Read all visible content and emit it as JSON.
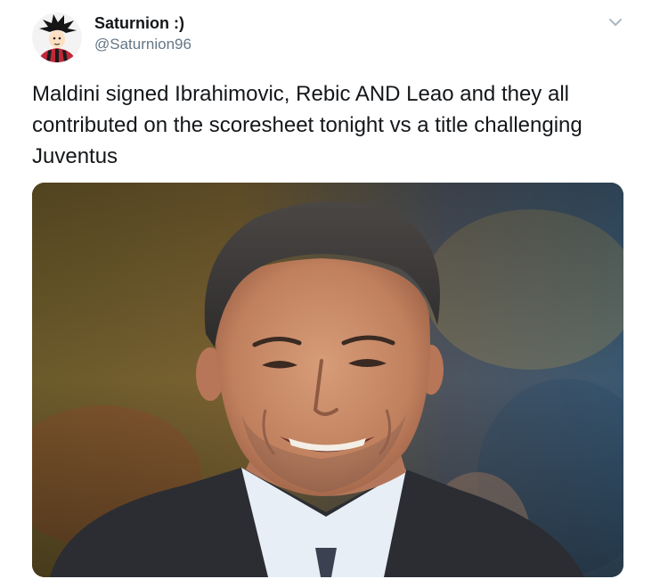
{
  "tweet": {
    "display_name": "Saturnion :)",
    "handle": "@Saturnion96",
    "text": "Maldini signed Ibrahimovic, Rebic AND Leao and they all contributed on the scoresheet tonight vs a title challenging Juventus",
    "avatar_icon": "cartoon-avatar",
    "menu_icon": "chevron-down-icon"
  },
  "colors": {
    "name": "#14171a",
    "handle": "#657786",
    "caret": "#aab8c2"
  }
}
